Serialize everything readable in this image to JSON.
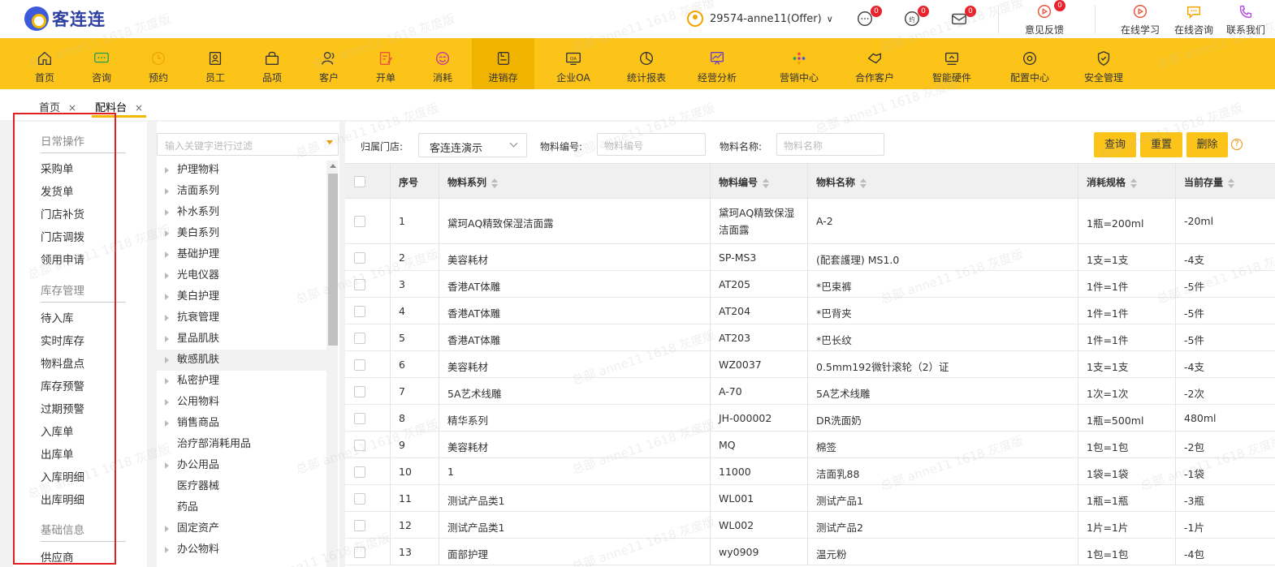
{
  "app": {
    "logo_text": "客连连"
  },
  "header": {
    "user": "29574-anne11(Offer)",
    "badges": {
      "messages": "0",
      "reservations": "0",
      "mail": "0",
      "feedback": "0"
    },
    "links": {
      "feedback": "意见反馈",
      "learn": "在线学习",
      "consult": "在线咨询",
      "contact": "联系我们"
    }
  },
  "nav": [
    "首页",
    "咨询",
    "预约",
    "员工",
    "品项",
    "客户",
    "开单",
    "消耗",
    "进销存",
    "企业OA",
    "统计报表",
    "经营分析",
    "营销中心",
    "合作客户",
    "智能硬件",
    "配置中心",
    "安全管理"
  ],
  "nav_active": "进销存",
  "tabs": {
    "home": "首页",
    "current": "配料台",
    "close": "×"
  },
  "sidebar": {
    "group1": "日常操作",
    "items1": [
      "采购单",
      "发货单",
      "门店补货",
      "门店调拨",
      "领用申请"
    ],
    "group2": "库存管理",
    "items2": [
      "待入库",
      "实时库存",
      "物料盘点",
      "库存预警",
      "过期预警",
      "入库单",
      "出库单",
      "入库明细",
      "出库明细"
    ],
    "group3": "基础信息",
    "items3": [
      "供应商"
    ]
  },
  "tree": {
    "search_placeholder": "输入关键字进行过滤",
    "items": [
      "护理物料",
      "洁面系列",
      "补水系列",
      "美白系列",
      "基础护理",
      "光电仪器",
      "美白护理",
      "抗衰管理",
      "星品肌肤",
      "敏感肌肤",
      "私密护理",
      "公用物料",
      "销售商品",
      "治疗部消耗用品",
      "办公用品",
      "医疗器械",
      "药品",
      "固定资产",
      "办公物料"
    ],
    "selected": "敏感肌肤"
  },
  "filters": {
    "store_label": "归属门店:",
    "store_value": "客连连演示",
    "code_label": "物料编号:",
    "code_placeholder": "物料编号",
    "name_label": "物料名称:",
    "name_placeholder": "物料名称"
  },
  "buttons": {
    "query": "查询",
    "reset": "重置",
    "delete": "删除",
    "help": "?"
  },
  "table": {
    "headers": [
      "序号",
      "物料系列",
      "物料编号",
      "物料名称",
      "消耗规格",
      "当前存量"
    ],
    "rows": [
      [
        "1",
        "黛珂AQ精致保湿洁面露",
        "黛珂AQ精致保湿洁面露",
        "A-2",
        "1瓶=200ml",
        "-20ml"
      ],
      [
        "2",
        "美容耗材",
        "SP-MS3",
        "(配套護理) MS1.0",
        "1支=1支",
        "-4支"
      ],
      [
        "3",
        "香港AT体雕",
        "AT205",
        "*巴束裤",
        "1件=1件",
        "-5件"
      ],
      [
        "4",
        "香港AT体雕",
        "AT204",
        "*巴背夹",
        "1件=1件",
        "-5件"
      ],
      [
        "5",
        "香港AT体雕",
        "AT203",
        "*巴长纹",
        "1件=1件",
        "-5件"
      ],
      [
        "6",
        "美容耗材",
        "WZ0037",
        "0.5mm192微针滚轮（2）证",
        "1支=1支",
        "-4支"
      ],
      [
        "7",
        "5A艺术线雕",
        "A-70",
        "5A艺术线雕",
        "1次=1次",
        "-2次"
      ],
      [
        "8",
        "精华系列",
        "JH-000002",
        "DR洗面奶",
        "1瓶=500ml",
        "480ml"
      ],
      [
        "9",
        "美容耗材",
        "MQ",
        "棉签",
        "1包=1包",
        "-2包"
      ],
      [
        "10",
        "1",
        "11000",
        "洁面乳88",
        "1袋=1袋",
        "-1袋"
      ],
      [
        "11",
        "测试产品类1",
        "WL001",
        "测试产品1",
        "1瓶=1瓶",
        "-3瓶"
      ],
      [
        "12",
        "测试产品类1",
        "WL002",
        "测试产品2",
        "1片=1片",
        "-1片"
      ],
      [
        "13",
        "面部护理",
        "wy0909",
        "温元粉",
        "1包=1包",
        "-4包"
      ]
    ]
  },
  "watermark": "总部 anne11 1618 灰度版"
}
